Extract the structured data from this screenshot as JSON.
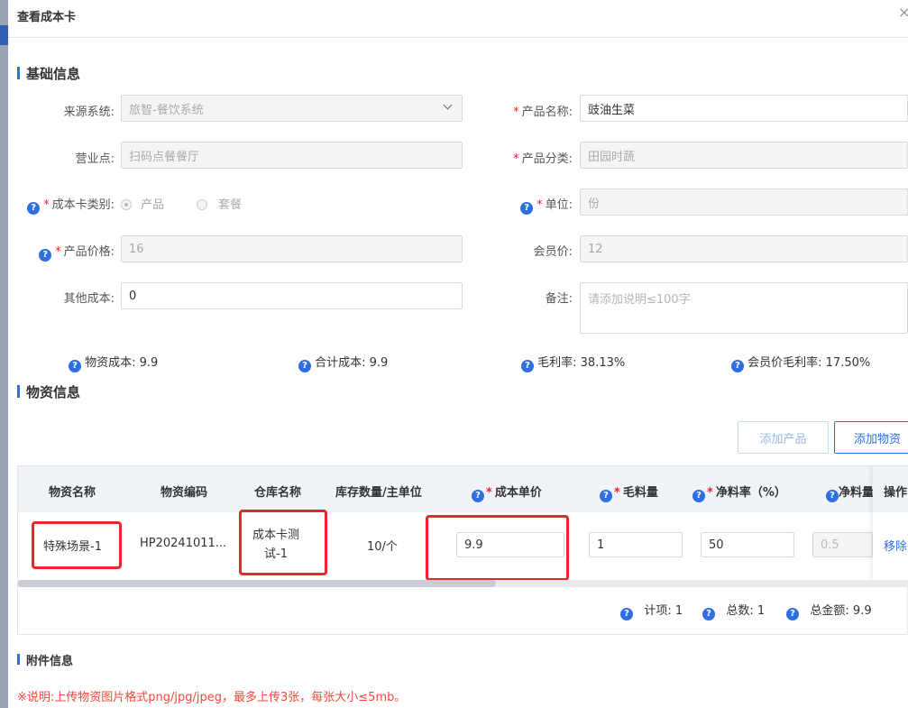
{
  "dialog": {
    "title": "查看成本卡",
    "close": "×"
  },
  "basic": {
    "title": "基础信息",
    "source_system": {
      "label": "来源系统:",
      "value": "旅智-餐饮系统"
    },
    "business_point": {
      "label": "营业点:",
      "value": "扫码点餐餐厅"
    },
    "card_type": {
      "label": "成本卡类别:",
      "options": [
        "产品",
        "套餐"
      ],
      "selected": "产品"
    },
    "product_price": {
      "label": "产品价格:",
      "value": "16"
    },
    "other_cost": {
      "label": "其他成本:",
      "value": "0"
    },
    "product_name": {
      "label": "产品名称:",
      "value": "豉油生菜"
    },
    "product_category": {
      "label": "产品分类:",
      "value": "田园时蔬"
    },
    "unit": {
      "label": "单位:",
      "value": "份"
    },
    "member_price": {
      "label": "会员价:",
      "value": "12"
    },
    "remark": {
      "label": "备注:",
      "placeholder": "请添加说明≤100字"
    },
    "stats": {
      "material_cost": "物资成本: 9.9",
      "total_cost": "合计成本: 9.9",
      "gross_margin": "毛利率: 38.13%",
      "member_gross_margin": "会员价毛利率: 17.50%"
    }
  },
  "materials": {
    "title": "物资信息",
    "add_product_label": "添加产品",
    "add_material_label": "添加物资",
    "columns": [
      "物资名称",
      "物资编码",
      "仓库名称",
      "库存数量/主单位",
      "成本单价",
      "毛料量",
      "净料率（%）",
      "净料量",
      "操作"
    ],
    "rows": [
      {
        "name": "特殊场景-1",
        "code": "HP20241011...",
        "warehouse_line1": "成本卡测",
        "warehouse_line2": "试-1",
        "stock": "10/个",
        "unit_cost": "9.9",
        "gross_qty": "1",
        "net_rate": "50",
        "net_qty": "0.5",
        "action": "移除"
      }
    ],
    "summary": {
      "items": "计项: 1",
      "total_count": "总数: 1",
      "total_amount": "总金额: 9.9"
    }
  },
  "attachments": {
    "title": "附件信息",
    "note": "※说明:上传物资图片格式png/jpg/jpeg，最多上传3张，每张大小≤5mb。"
  },
  "colors": {
    "accent": "#2f6fe0",
    "required": "#f5222d",
    "highlight": "#e8262b",
    "note": "#f5483b"
  }
}
